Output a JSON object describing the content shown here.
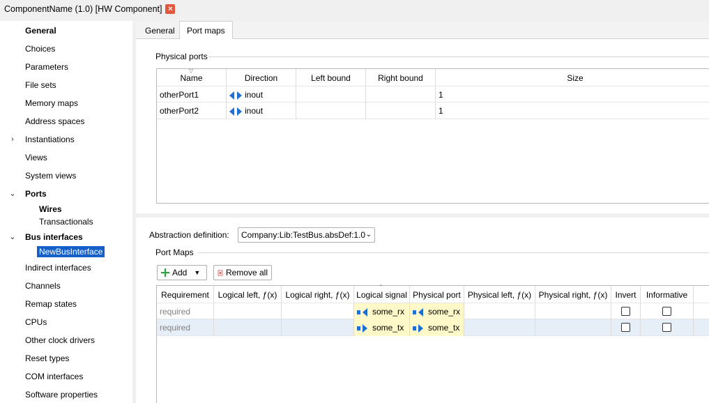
{
  "window": {
    "title": "ComponentName (1.0) [HW Component]"
  },
  "sidebar": {
    "items": [
      {
        "label": "General"
      },
      {
        "label": "Choices"
      },
      {
        "label": "Parameters"
      },
      {
        "label": "File sets"
      },
      {
        "label": "Memory maps"
      },
      {
        "label": "Address spaces"
      },
      {
        "label": "Instantiations"
      },
      {
        "label": "Views"
      },
      {
        "label": "System views"
      },
      {
        "label": "Ports"
      },
      {
        "label": "Wires"
      },
      {
        "label": "Transactionals"
      },
      {
        "label": "Bus interfaces"
      },
      {
        "label": "NewBusInterface"
      },
      {
        "label": "Indirect interfaces"
      },
      {
        "label": "Channels"
      },
      {
        "label": "Remap states"
      },
      {
        "label": "CPUs"
      },
      {
        "label": "Other clock drivers"
      },
      {
        "label": "Reset types"
      },
      {
        "label": "COM interfaces"
      },
      {
        "label": "Software properties"
      }
    ]
  },
  "tabs": [
    {
      "label": "General"
    },
    {
      "label": "Port maps"
    }
  ],
  "physical_ports": {
    "group_label": "Physical ports",
    "columns": [
      "Name",
      "Direction",
      "Left bound",
      "Right bound",
      "Size"
    ],
    "rows": [
      {
        "name": "otherPort1",
        "direction": "inout",
        "left": "",
        "right": "",
        "size": "1"
      },
      {
        "name": "otherPort2",
        "direction": "inout",
        "left": "",
        "right": "",
        "size": "1"
      }
    ]
  },
  "abstraction": {
    "label": "Abstraction definition:",
    "value": "Company:Lib:TestBus.absDef:1.0"
  },
  "port_maps": {
    "group_label": "Port Maps",
    "add_label": "Add",
    "remove_all_label": "Remove all",
    "columns": [
      "Requirement",
      "Logical left, ƒ(x)",
      "Logical right, ƒ(x)",
      "Logical signal",
      "Physical port",
      "Physical left, ƒ(x)",
      "Physical right, ƒ(x)",
      "Invert",
      "Informative"
    ],
    "rows": [
      {
        "requirement": "required",
        "logical_signal": "some_rx",
        "physical_port": "some_rx",
        "invert": false,
        "informative": false
      },
      {
        "requirement": "required",
        "logical_signal": "some_tx",
        "physical_port": "some_tx",
        "invert": false,
        "informative": false
      }
    ]
  },
  "colors": {
    "selection": "#1560c8",
    "highlight": "#fff8c8",
    "icon_blue": "#1f6fd0",
    "close_red": "#e2583e"
  }
}
